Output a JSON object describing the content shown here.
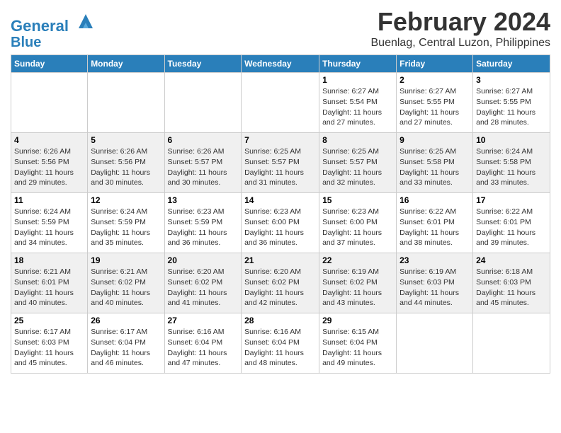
{
  "header": {
    "logo_line1": "General",
    "logo_line2": "Blue",
    "month_title": "February 2024",
    "location": "Buenlag, Central Luzon, Philippines"
  },
  "days_of_week": [
    "Sunday",
    "Monday",
    "Tuesday",
    "Wednesday",
    "Thursday",
    "Friday",
    "Saturday"
  ],
  "weeks": [
    [
      {
        "day": "",
        "info": ""
      },
      {
        "day": "",
        "info": ""
      },
      {
        "day": "",
        "info": ""
      },
      {
        "day": "",
        "info": ""
      },
      {
        "day": "1",
        "info": "Sunrise: 6:27 AM\nSunset: 5:54 PM\nDaylight: 11 hours\nand 27 minutes."
      },
      {
        "day": "2",
        "info": "Sunrise: 6:27 AM\nSunset: 5:55 PM\nDaylight: 11 hours\nand 27 minutes."
      },
      {
        "day": "3",
        "info": "Sunrise: 6:27 AM\nSunset: 5:55 PM\nDaylight: 11 hours\nand 28 minutes."
      }
    ],
    [
      {
        "day": "4",
        "info": "Sunrise: 6:26 AM\nSunset: 5:56 PM\nDaylight: 11 hours\nand 29 minutes."
      },
      {
        "day": "5",
        "info": "Sunrise: 6:26 AM\nSunset: 5:56 PM\nDaylight: 11 hours\nand 30 minutes."
      },
      {
        "day": "6",
        "info": "Sunrise: 6:26 AM\nSunset: 5:57 PM\nDaylight: 11 hours\nand 30 minutes."
      },
      {
        "day": "7",
        "info": "Sunrise: 6:25 AM\nSunset: 5:57 PM\nDaylight: 11 hours\nand 31 minutes."
      },
      {
        "day": "8",
        "info": "Sunrise: 6:25 AM\nSunset: 5:57 PM\nDaylight: 11 hours\nand 32 minutes."
      },
      {
        "day": "9",
        "info": "Sunrise: 6:25 AM\nSunset: 5:58 PM\nDaylight: 11 hours\nand 33 minutes."
      },
      {
        "day": "10",
        "info": "Sunrise: 6:24 AM\nSunset: 5:58 PM\nDaylight: 11 hours\nand 33 minutes."
      }
    ],
    [
      {
        "day": "11",
        "info": "Sunrise: 6:24 AM\nSunset: 5:59 PM\nDaylight: 11 hours\nand 34 minutes."
      },
      {
        "day": "12",
        "info": "Sunrise: 6:24 AM\nSunset: 5:59 PM\nDaylight: 11 hours\nand 35 minutes."
      },
      {
        "day": "13",
        "info": "Sunrise: 6:23 AM\nSunset: 5:59 PM\nDaylight: 11 hours\nand 36 minutes."
      },
      {
        "day": "14",
        "info": "Sunrise: 6:23 AM\nSunset: 6:00 PM\nDaylight: 11 hours\nand 36 minutes."
      },
      {
        "day": "15",
        "info": "Sunrise: 6:23 AM\nSunset: 6:00 PM\nDaylight: 11 hours\nand 37 minutes."
      },
      {
        "day": "16",
        "info": "Sunrise: 6:22 AM\nSunset: 6:01 PM\nDaylight: 11 hours\nand 38 minutes."
      },
      {
        "day": "17",
        "info": "Sunrise: 6:22 AM\nSunset: 6:01 PM\nDaylight: 11 hours\nand 39 minutes."
      }
    ],
    [
      {
        "day": "18",
        "info": "Sunrise: 6:21 AM\nSunset: 6:01 PM\nDaylight: 11 hours\nand 40 minutes."
      },
      {
        "day": "19",
        "info": "Sunrise: 6:21 AM\nSunset: 6:02 PM\nDaylight: 11 hours\nand 40 minutes."
      },
      {
        "day": "20",
        "info": "Sunrise: 6:20 AM\nSunset: 6:02 PM\nDaylight: 11 hours\nand 41 minutes."
      },
      {
        "day": "21",
        "info": "Sunrise: 6:20 AM\nSunset: 6:02 PM\nDaylight: 11 hours\nand 42 minutes."
      },
      {
        "day": "22",
        "info": "Sunrise: 6:19 AM\nSunset: 6:02 PM\nDaylight: 11 hours\nand 43 minutes."
      },
      {
        "day": "23",
        "info": "Sunrise: 6:19 AM\nSunset: 6:03 PM\nDaylight: 11 hours\nand 44 minutes."
      },
      {
        "day": "24",
        "info": "Sunrise: 6:18 AM\nSunset: 6:03 PM\nDaylight: 11 hours\nand 45 minutes."
      }
    ],
    [
      {
        "day": "25",
        "info": "Sunrise: 6:17 AM\nSunset: 6:03 PM\nDaylight: 11 hours\nand 45 minutes."
      },
      {
        "day": "26",
        "info": "Sunrise: 6:17 AM\nSunset: 6:04 PM\nDaylight: 11 hours\nand 46 minutes."
      },
      {
        "day": "27",
        "info": "Sunrise: 6:16 AM\nSunset: 6:04 PM\nDaylight: 11 hours\nand 47 minutes."
      },
      {
        "day": "28",
        "info": "Sunrise: 6:16 AM\nSunset: 6:04 PM\nDaylight: 11 hours\nand 48 minutes."
      },
      {
        "day": "29",
        "info": "Sunrise: 6:15 AM\nSunset: 6:04 PM\nDaylight: 11 hours\nand 49 minutes."
      },
      {
        "day": "",
        "info": ""
      },
      {
        "day": "",
        "info": ""
      }
    ]
  ]
}
